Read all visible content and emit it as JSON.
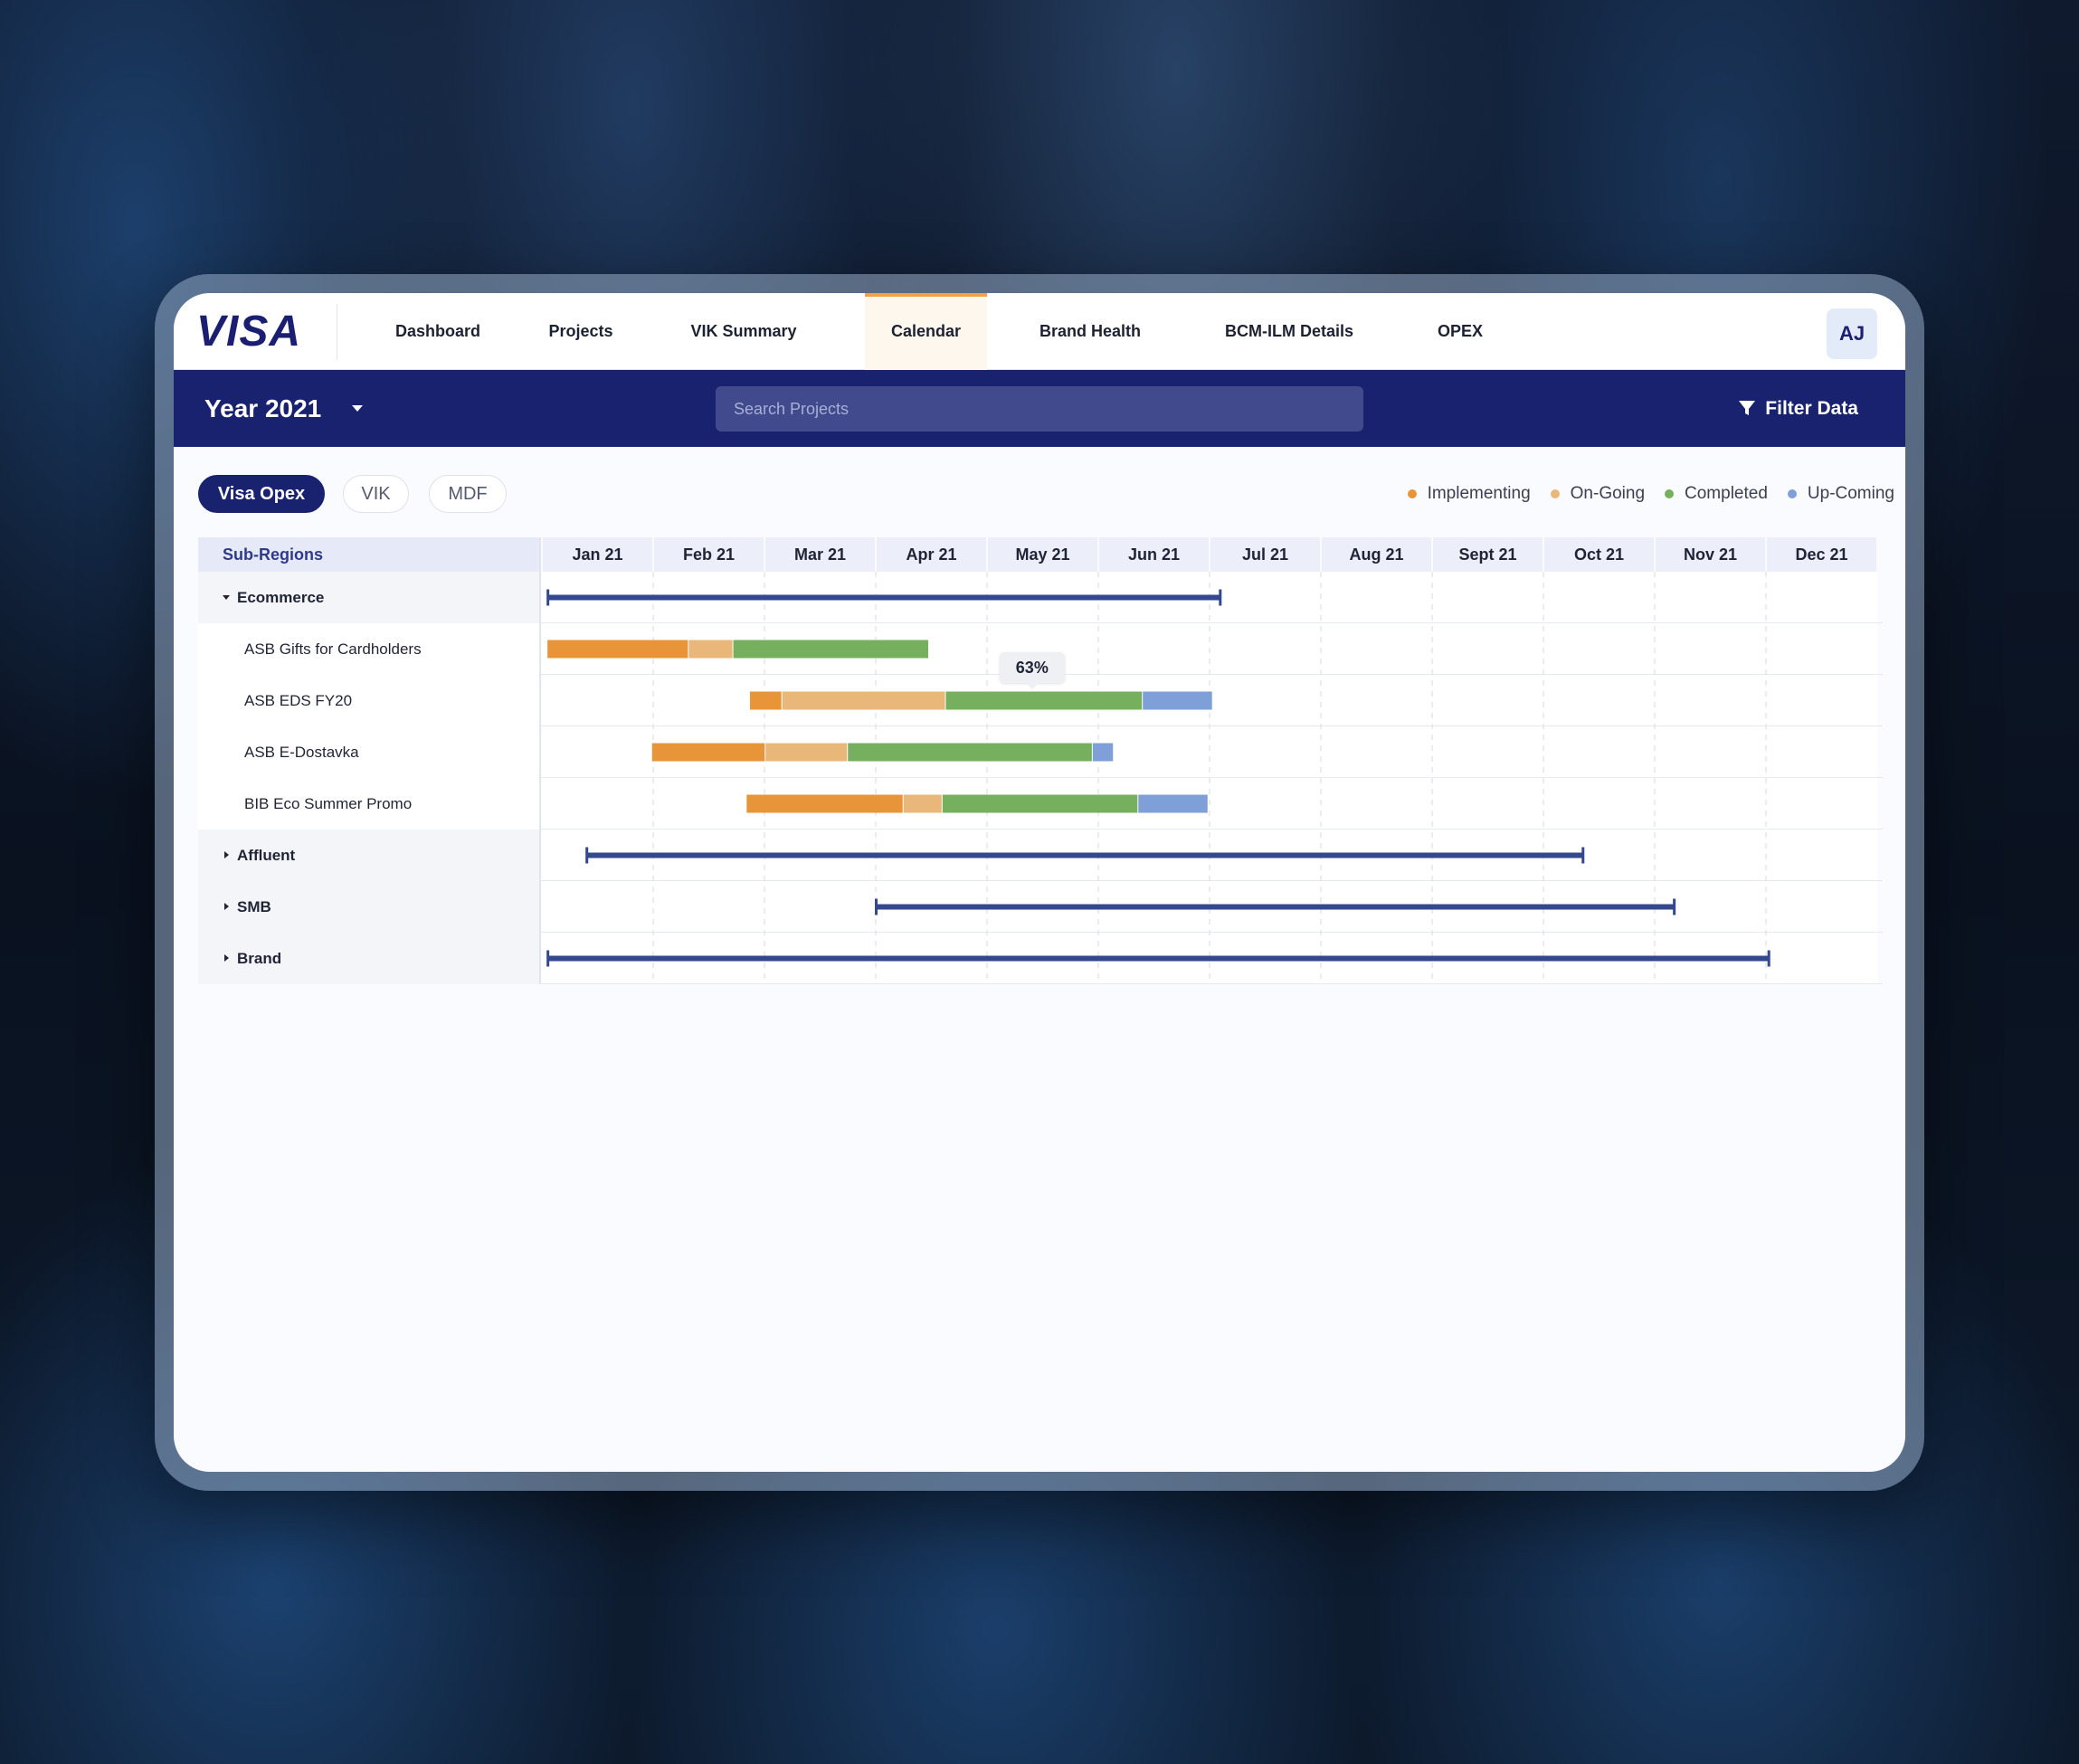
{
  "app": {
    "logo": "VISA",
    "nav": [
      {
        "label": "Dashboard",
        "active": false
      },
      {
        "label": "Projects",
        "active": false
      },
      {
        "label": "VIK Summary",
        "active": false
      },
      {
        "label": "Calendar",
        "active": true
      },
      {
        "label": "Brand Health",
        "active": false
      },
      {
        "label": "BCM-ILM Details",
        "active": false
      },
      {
        "label": "OPEX",
        "active": false
      }
    ],
    "avatar_initials": "AJ"
  },
  "subbar": {
    "year_label": "Year 2021",
    "search_placeholder": "Search Projects",
    "filter_label": "Filter Data"
  },
  "toggles": [
    {
      "label": "Visa Opex",
      "active": true
    },
    {
      "label": "VIK",
      "active": false
    },
    {
      "label": "MDF",
      "active": false
    }
  ],
  "legend": [
    {
      "label": "Implementing",
      "color": "#e8953a"
    },
    {
      "label": "On-Going",
      "color": "#eab77a"
    },
    {
      "label": "Completed",
      "color": "#76b05e"
    },
    {
      "label": "Up-Coming",
      "color": "#7e9fd8"
    }
  ],
  "colors": {
    "brand": "#1a1f71",
    "subbar": "#19226e",
    "summary_bar": "#33488f",
    "active_tab_accent": "#f0a14a"
  },
  "gantt": {
    "column_header": "Sub-Regions",
    "months": [
      "Jan 21",
      "Feb 21",
      "Mar 21",
      "Apr 21",
      "May 21",
      "Jun 21",
      "Jul 21",
      "Aug 21",
      "Sept 21",
      "Oct 21",
      "Nov 21",
      "Dec 21"
    ],
    "rows": [
      {
        "label": "Ecommerce",
        "type": "group",
        "expanded": true,
        "summary": [
          0.05,
          6.1
        ]
      },
      {
        "label": "ASB Gifts for Cardholders",
        "type": "task",
        "segments": [
          {
            "status": "Implementing",
            "start": 0.05,
            "end": 1.32
          },
          {
            "status": "On-Going",
            "start": 1.32,
            "end": 1.72
          },
          {
            "status": "Completed",
            "start": 1.72,
            "end": 3.48
          }
        ]
      },
      {
        "label": "ASB EDS FY20",
        "type": "task",
        "tooltip": {
          "text": "63%",
          "at": 4.47
        },
        "segments": [
          {
            "status": "Implementing",
            "start": 1.87,
            "end": 2.16
          },
          {
            "status": "On-Going",
            "start": 2.16,
            "end": 3.63
          },
          {
            "status": "Completed",
            "start": 3.63,
            "end": 5.4
          },
          {
            "status": "Up-Coming",
            "start": 5.4,
            "end": 6.03
          }
        ]
      },
      {
        "label": "ASB E-Dostavka",
        "type": "task",
        "segments": [
          {
            "status": "Implementing",
            "start": 0.99,
            "end": 2.01
          },
          {
            "status": "On-Going",
            "start": 2.01,
            "end": 2.75
          },
          {
            "status": "Completed",
            "start": 2.75,
            "end": 4.95
          },
          {
            "status": "Up-Coming",
            "start": 4.95,
            "end": 5.14
          }
        ]
      },
      {
        "label": "BIB Eco Summer Promo",
        "type": "task",
        "segments": [
          {
            "status": "Implementing",
            "start": 1.84,
            "end": 3.25
          },
          {
            "status": "On-Going",
            "start": 3.25,
            "end": 3.6
          },
          {
            "status": "Completed",
            "start": 3.6,
            "end": 5.36
          },
          {
            "status": "Up-Coming",
            "start": 5.36,
            "end": 5.99
          }
        ]
      },
      {
        "label": "Affluent",
        "type": "group",
        "expanded": false,
        "summary": [
          0.4,
          9.36
        ]
      },
      {
        "label": "SMB",
        "type": "group",
        "expanded": false,
        "summary": [
          3.0,
          10.18
        ]
      },
      {
        "label": "Brand",
        "type": "group",
        "expanded": false,
        "summary": [
          0.05,
          11.03
        ]
      }
    ]
  }
}
